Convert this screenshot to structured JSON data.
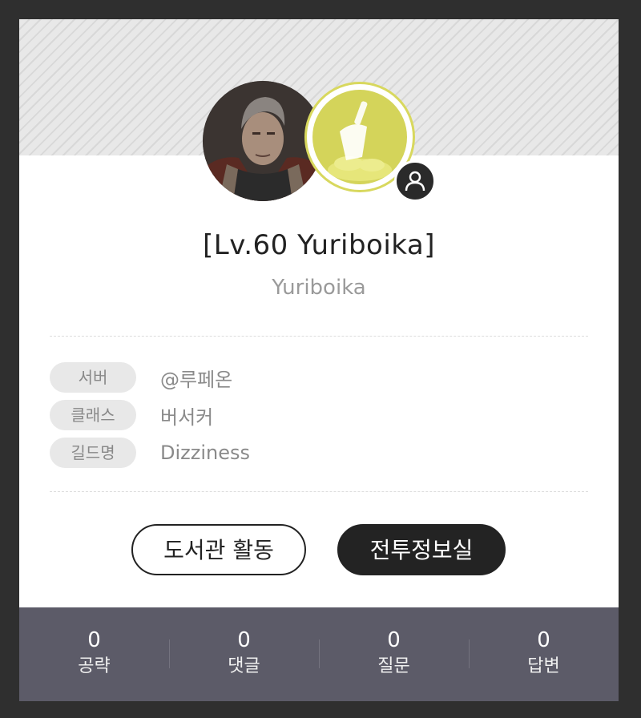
{
  "profile": {
    "title": "[Lv.60 Yuriboika]",
    "name": "Yuriboika"
  },
  "info": [
    {
      "label": "서버",
      "value": "@루페온"
    },
    {
      "label": "클래스",
      "value": "버서커"
    },
    {
      "label": "길드명",
      "value": "Dizziness"
    }
  ],
  "buttons": {
    "library": "도서관 활동",
    "battle": "전투정보실"
  },
  "stats": [
    {
      "count": "0",
      "label": "공략"
    },
    {
      "count": "0",
      "label": "댓글"
    },
    {
      "count": "0",
      "label": "질문"
    },
    {
      "count": "0",
      "label": "답변"
    }
  ],
  "colors": {
    "background": "#2f2f2f",
    "badge_accent": "#d4d45a",
    "stats_bar": "#5c5b68",
    "dark_button": "#232323"
  },
  "icons": {
    "badge": "trowel-icon",
    "profile_link": "user-icon"
  }
}
